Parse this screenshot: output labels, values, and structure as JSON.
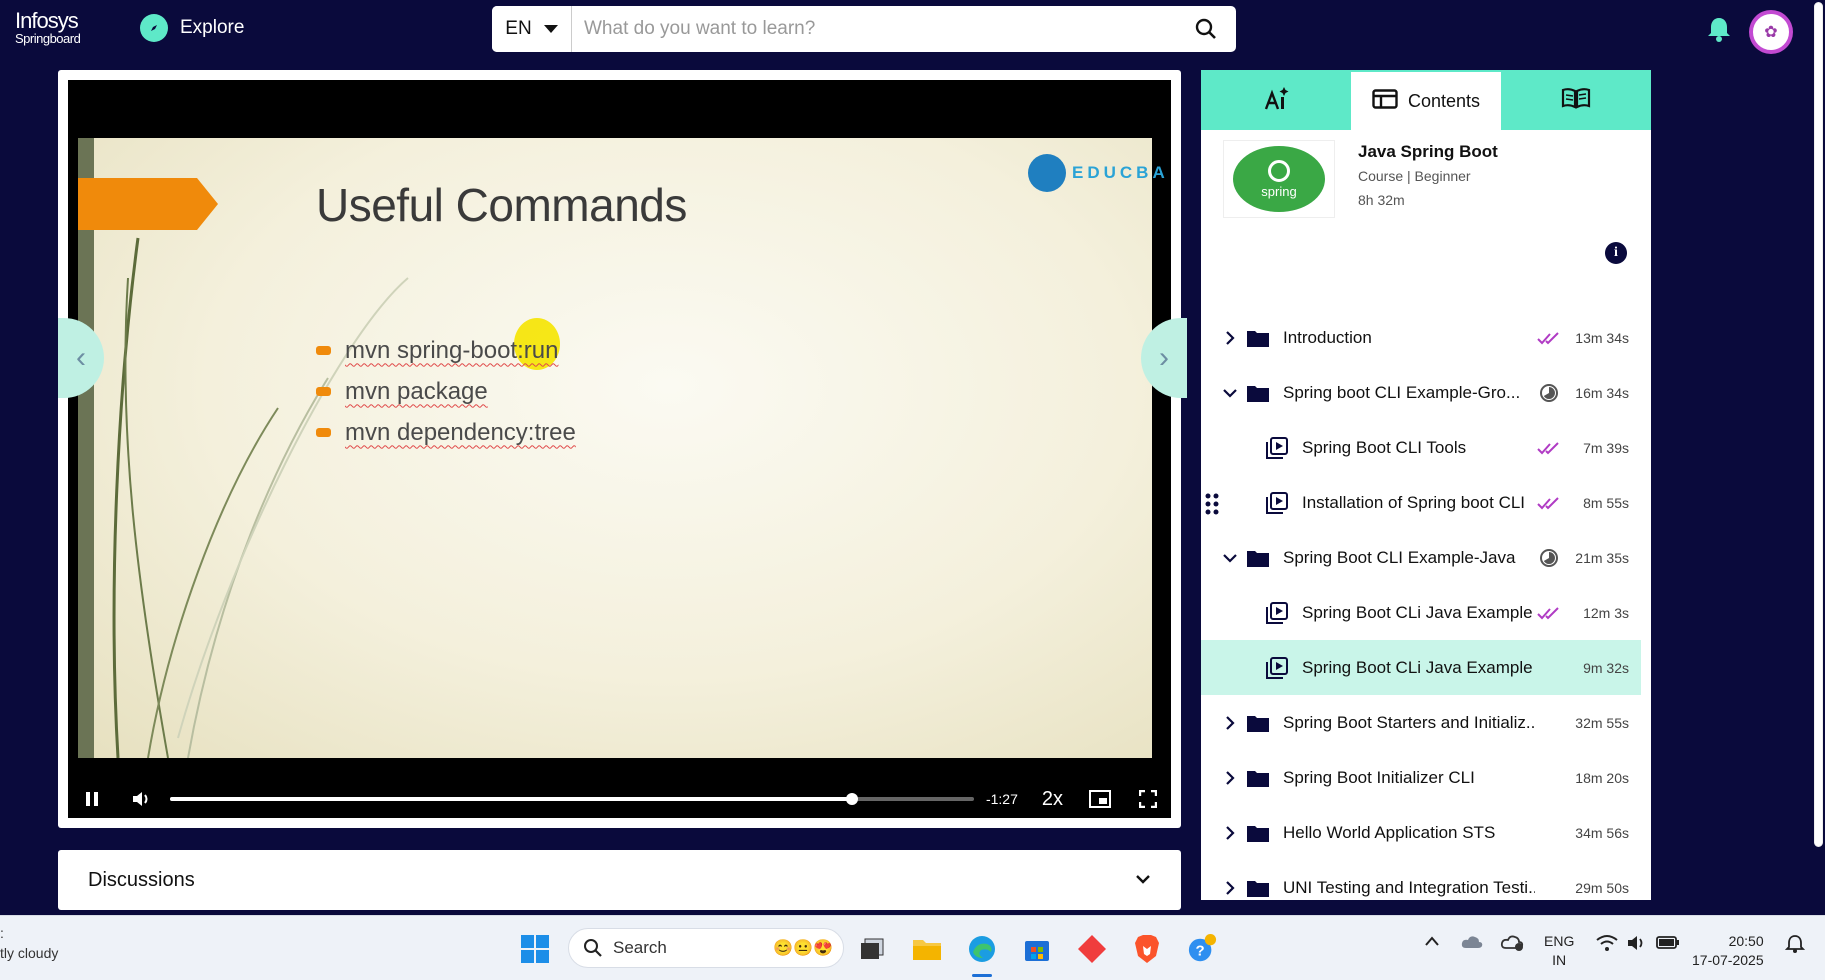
{
  "app": {
    "logo_line1": "Infosys",
    "logo_line2": "Springboard",
    "explore_label": "Explore",
    "language": "EN",
    "search_placeholder": "What do you want to learn?"
  },
  "video": {
    "slide_title": "Useful Commands",
    "bullets": [
      "mvn spring-boot:run",
      "mvn package",
      "mvn dependency:tree"
    ],
    "watermark": "EDUCBA",
    "time_remaining": "-1:27",
    "speed": "2x",
    "progress_fraction": 0.848
  },
  "discussions": {
    "title": "Discussions"
  },
  "panel": {
    "tabs": [
      {
        "label": "",
        "icon": "ai-assistant-icon"
      },
      {
        "label": "Contents",
        "icon": "contents-icon"
      },
      {
        "label": "",
        "icon": "notes-book-icon"
      }
    ],
    "course": {
      "title": "Java Spring Boot",
      "meta": "Course | Beginner",
      "duration": "8h 32m",
      "thumb_text": "spring"
    },
    "items": [
      {
        "label": "Introduction",
        "type": "folder",
        "expand": "collapsed",
        "status": "done",
        "duration": "13m 34s"
      },
      {
        "label": "Spring boot CLI Example-Gro...",
        "type": "folder",
        "expand": "expanded",
        "status": "partial",
        "duration": "16m 34s"
      },
      {
        "label": "Spring Boot CLI Tools",
        "type": "video",
        "status": "done",
        "duration": "7m 39s"
      },
      {
        "label": "Installation of Spring boot CLI",
        "type": "video",
        "status": "done",
        "duration": "8m 55s"
      },
      {
        "label": "Spring Boot CLI Example-Java",
        "type": "folder",
        "expand": "expanded",
        "status": "partial",
        "duration": "21m 35s"
      },
      {
        "label": "Spring Boot CLi Java Example",
        "type": "video",
        "status": "done",
        "duration": "12m 3s"
      },
      {
        "label": "Spring Boot CLi Java Example C...",
        "type": "video",
        "status": "active",
        "duration": "9m 32s"
      },
      {
        "label": "Spring Boot Starters and Initializ...",
        "type": "folder",
        "expand": "collapsed",
        "status": "none",
        "duration": "32m 55s"
      },
      {
        "label": "Spring Boot Initializer CLI",
        "type": "folder",
        "expand": "collapsed",
        "status": "none",
        "duration": "18m 20s"
      },
      {
        "label": "Hello World Application STS",
        "type": "folder",
        "expand": "collapsed",
        "status": "none",
        "duration": "34m 56s"
      },
      {
        "label": "UNI Testing and Integration Testi...",
        "type": "folder",
        "expand": "collapsed",
        "status": "none",
        "duration": "29m 50s"
      }
    ]
  },
  "taskbar": {
    "weather": "tly cloudy",
    "search_label": "Search",
    "lang_line1": "ENG",
    "lang_line2": "IN",
    "time": "20:50",
    "date": "17-07-2025"
  },
  "colors": {
    "nav_bg": "#0a0a3c",
    "accent_teal": "#5ee9c8",
    "active_row": "#c9f5e9",
    "check_purple": "#b03bc4"
  }
}
